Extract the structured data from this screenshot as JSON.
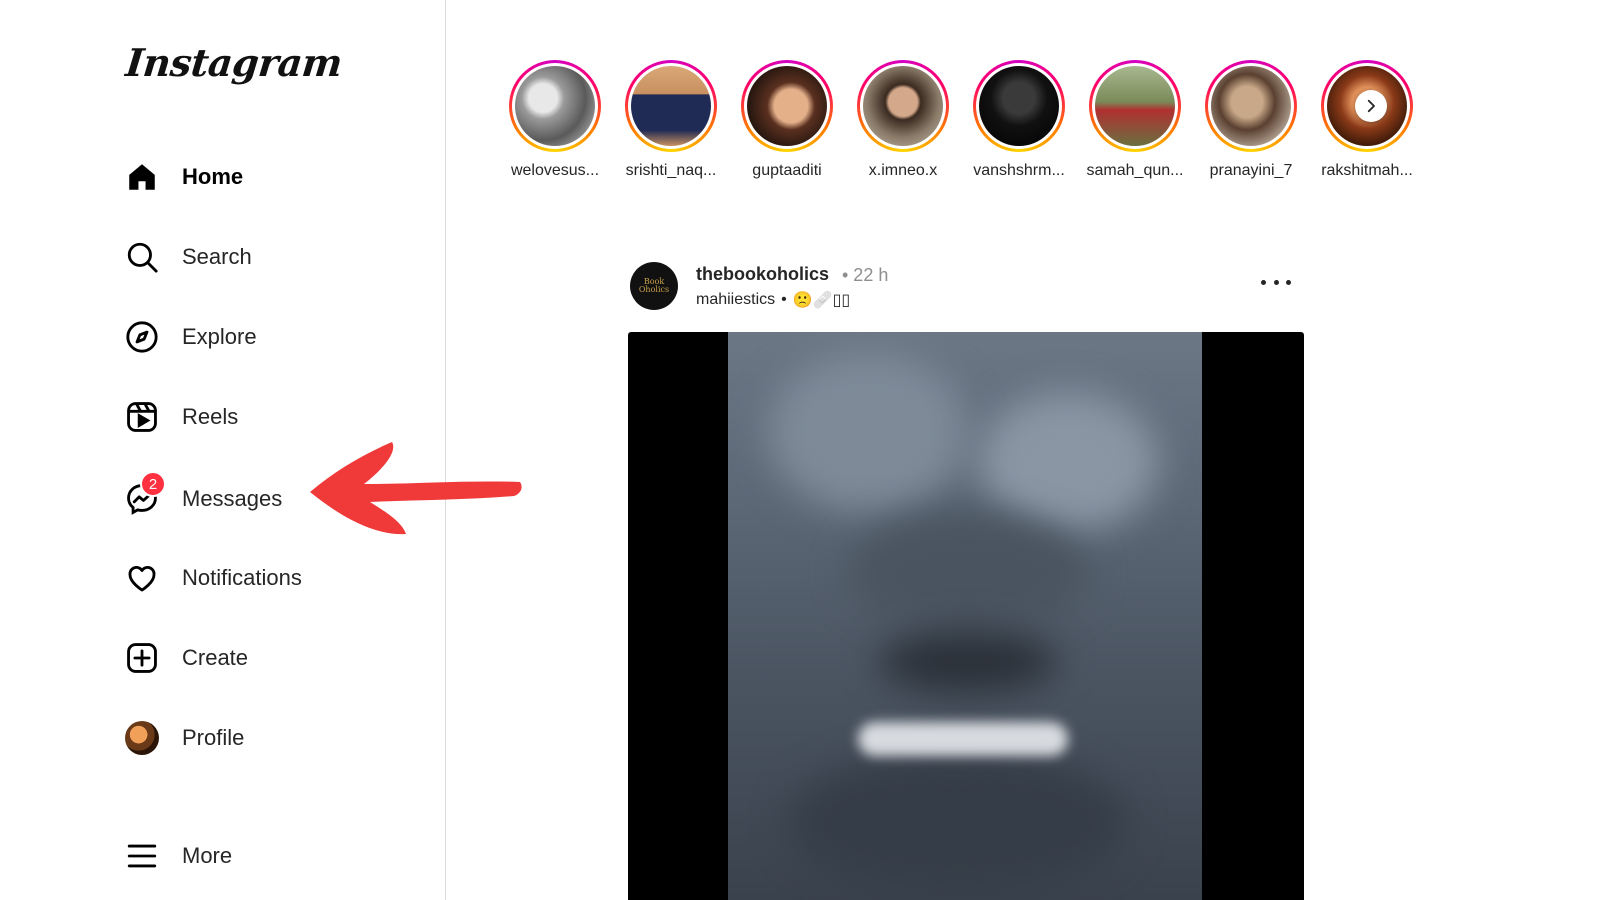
{
  "app": {
    "logo_text": "Instagram"
  },
  "sidebar": {
    "items": [
      {
        "label": "Home",
        "icon": "home-icon",
        "active": true
      },
      {
        "label": "Search",
        "icon": "search-icon"
      },
      {
        "label": "Explore",
        "icon": "compass-icon"
      },
      {
        "label": "Reels",
        "icon": "reels-icon"
      },
      {
        "label": "Messages",
        "icon": "messenger-icon",
        "badge": "2"
      },
      {
        "label": "Notifications",
        "icon": "heart-icon"
      },
      {
        "label": "Create",
        "icon": "plus-square-icon"
      },
      {
        "label": "Profile",
        "icon": "avatar"
      },
      {
        "label": "More",
        "icon": "menu-icon"
      }
    ]
  },
  "stories": [
    {
      "username": "welovesus..."
    },
    {
      "username": "srishti_naq..."
    },
    {
      "username": "guptaaditi"
    },
    {
      "username": "x.imneo.x"
    },
    {
      "username": "vanshshrm..."
    },
    {
      "username": "samah_qun..."
    },
    {
      "username": "pranayini_7"
    },
    {
      "username": "rakshitmah..."
    }
  ],
  "post": {
    "username": "thebookoholics",
    "time": "• 22 h",
    "subline_user": "mahiiestics",
    "subline_sep": "•",
    "subline_extra": "🙁🩹▯▯",
    "avatar_text": "Book Oholics"
  },
  "colors": {
    "badge": "#ff3040",
    "annotation_arrow": "#f03a3a",
    "story_ring": "#d300c5"
  }
}
